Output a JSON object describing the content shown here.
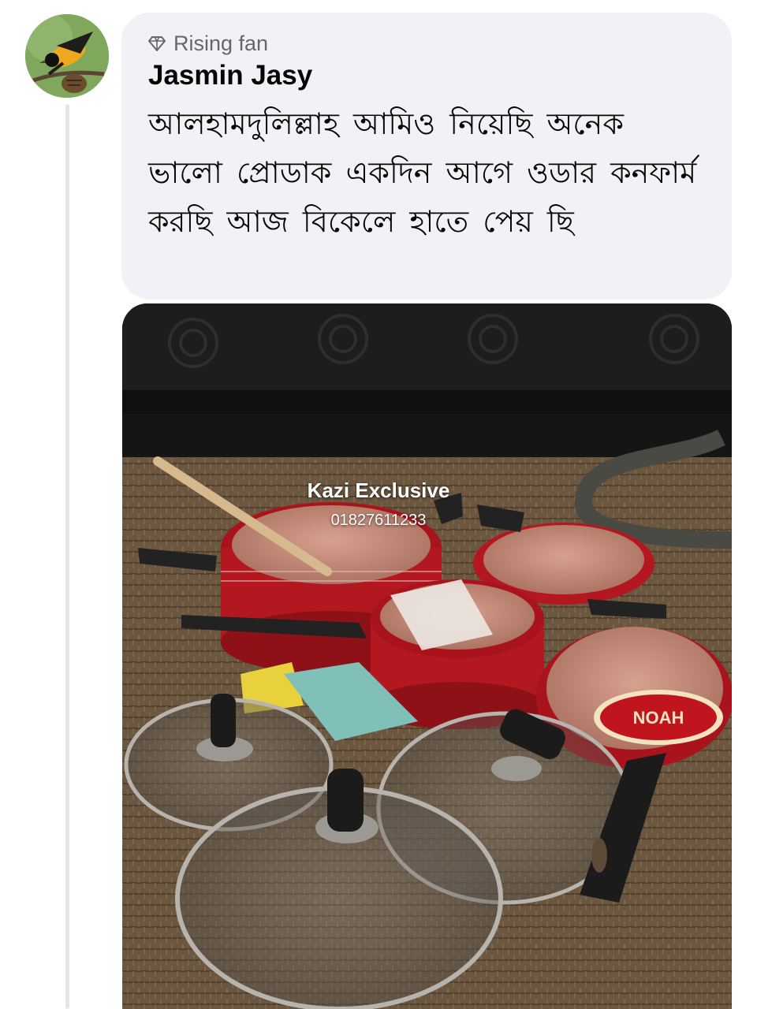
{
  "comment": {
    "badge": {
      "icon": "diamond-icon",
      "label": "Rising fan"
    },
    "author": "Jasmin Jasy",
    "text": "আলহামদুলিল্লাহ আমিও নিয়েছি অনেক ভালো প্রোডাক একদিন আগে ওডার কনফার্ম করছি আজ বিকেলে হাতে পেয় ছি"
  },
  "photo": {
    "watermark_name": "Kazi Exclusive",
    "watermark_phone": "01827611233",
    "label_brand": "NOAH"
  },
  "colors": {
    "bubble_bg": "#f0f2f5",
    "secondary_text": "#65676b",
    "primary_text": "#050505",
    "pan_red": "#b3171f"
  }
}
